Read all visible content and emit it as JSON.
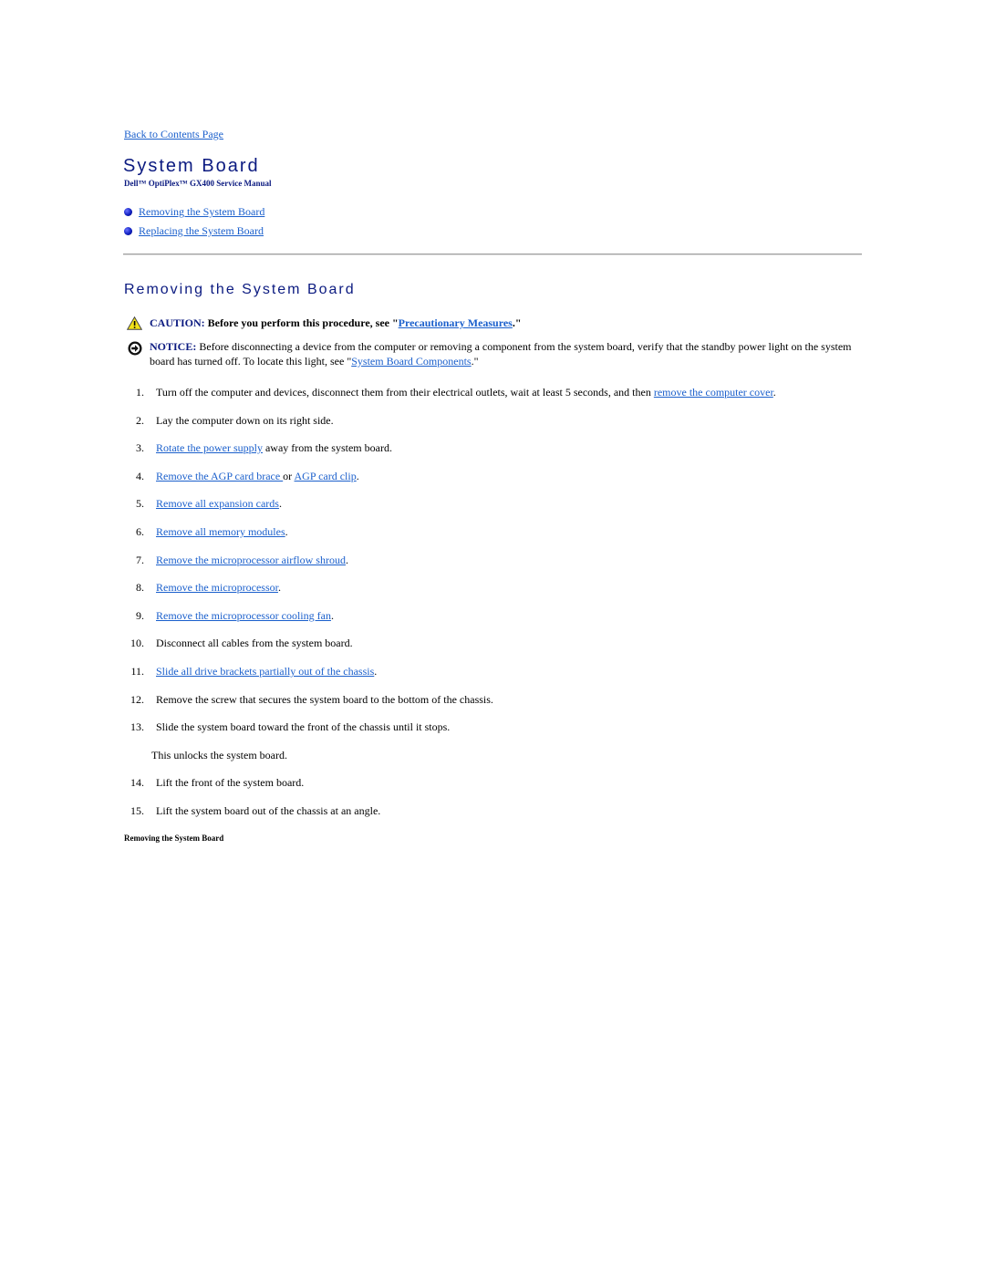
{
  "nav": {
    "back_link": "Back to Contents Page"
  },
  "header": {
    "title": "System Board",
    "manual_name": "Dell™ OptiPlex™ GX400 Service Manual"
  },
  "toc": [
    {
      "label": "Removing the System Board"
    },
    {
      "label": "Replacing the System Board"
    }
  ],
  "section": {
    "title": "Removing the System Board",
    "caution": {
      "label": "CAUTION:",
      "text_before": " Before you perform this procedure, see \"",
      "link": "Precautionary Measures",
      "text_after": ".\""
    },
    "notice": {
      "label": "NOTICE:",
      "text_before": " Before disconnecting a device from the computer or removing a component from the system board, verify that the standby power light on the system board has turned off. To locate this light, see \"",
      "link": "System Board Components",
      "text_after": ".\""
    },
    "steps": [
      {
        "num": "1.",
        "text": "Turn off the computer and devices, disconnect them from their electrical outlets, wait at least 5 seconds, and then ",
        "link": "remove the computer cover",
        "after": "."
      },
      {
        "num": "2.",
        "text": "Lay the computer down on its right side."
      },
      {
        "num": "3.",
        "link": "Rotate the power supply",
        "after": " away from the system board."
      },
      {
        "num": "4.",
        "link": "Remove the AGP card brace ",
        "mid": "or ",
        "link2": "AGP card clip",
        "after": "."
      },
      {
        "num": "5.",
        "link": "Remove all expansion cards",
        "after": "."
      },
      {
        "num": "6.",
        "link": "Remove all memory modules",
        "after": "."
      },
      {
        "num": "7.",
        "link": "Remove the microprocessor airflow shroud",
        "after": "."
      },
      {
        "num": "8.",
        "link": "Remove the microprocessor",
        "after": "."
      },
      {
        "num": "9.",
        "link": "Remove the microprocessor cooling fan",
        "after": "."
      },
      {
        "num": "10.",
        "text": "Disconnect all cables from the system board."
      },
      {
        "num": "11.",
        "link": "Slide all drive brackets partially out of the chassis",
        "after": "."
      },
      {
        "num": "12.",
        "text": "Remove the screw that secures the system board to the bottom of the chassis."
      },
      {
        "num": "13.",
        "text": "Slide the system board toward the front of the chassis until it stops."
      },
      {
        "note": "This unlocks the system board."
      },
      {
        "num": "14.",
        "text": "Lift the front of the system board."
      },
      {
        "num": "15.",
        "text": "Lift the system board out of the chassis at an angle."
      }
    ],
    "figure_caption": "Removing the System Board"
  }
}
